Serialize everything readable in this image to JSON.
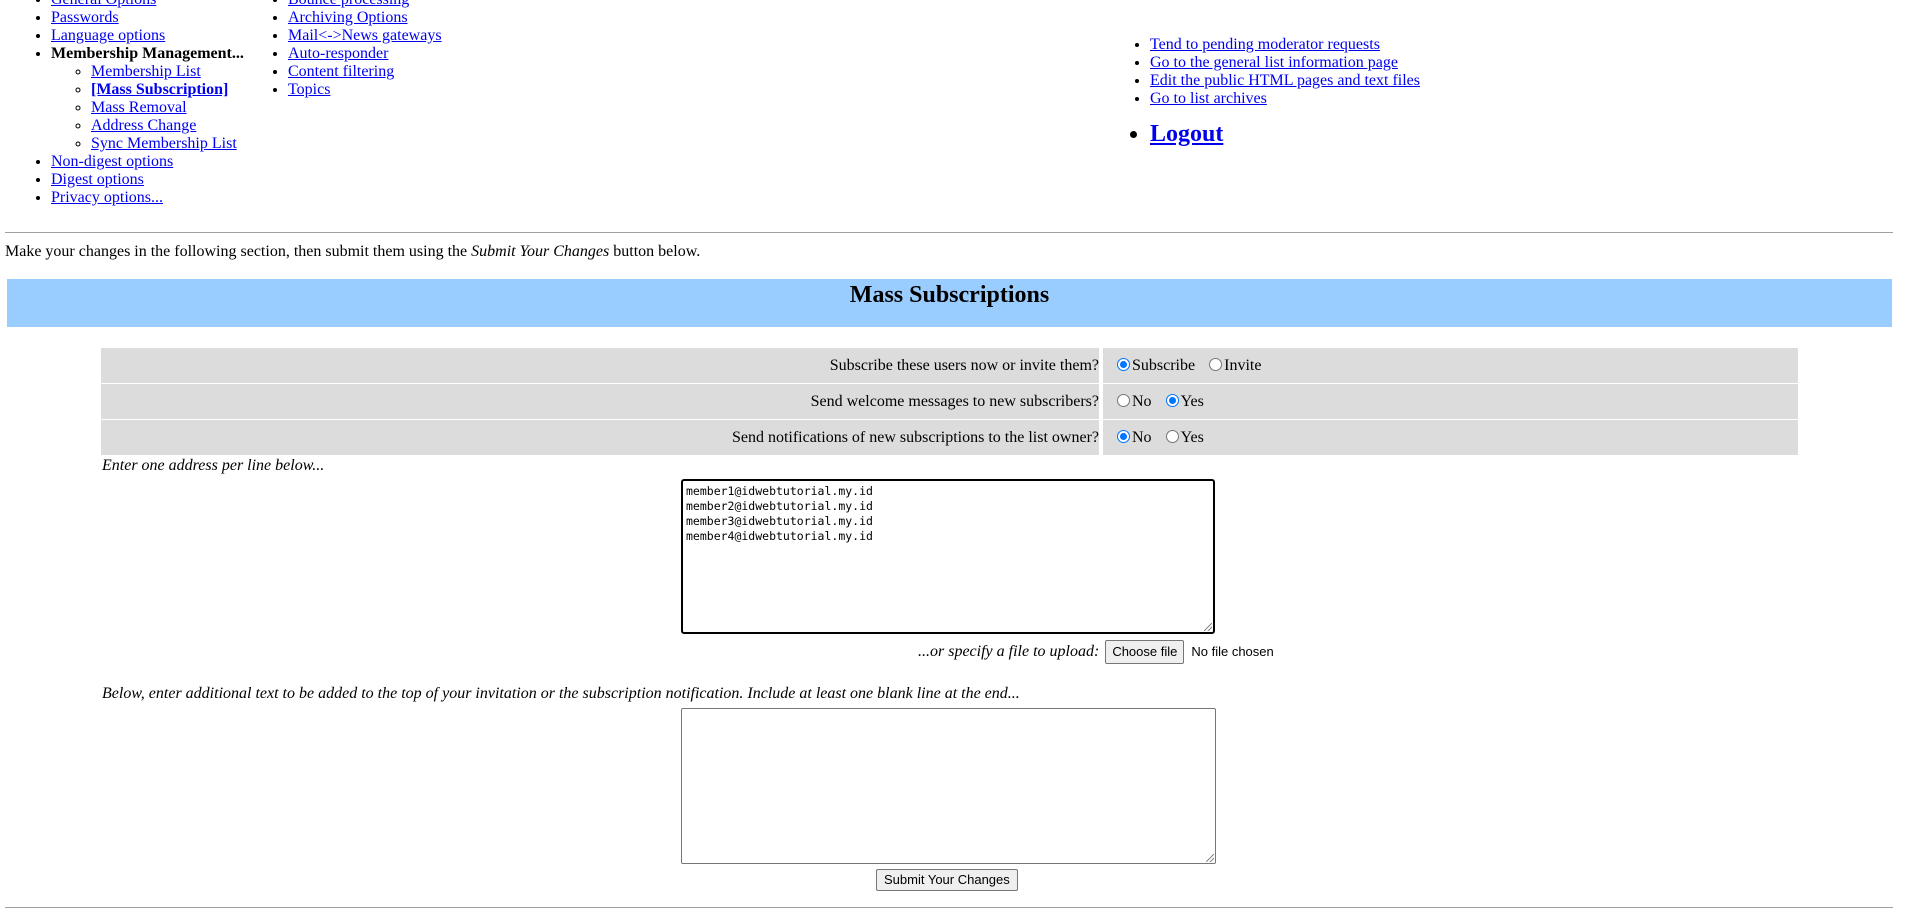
{
  "nav": {
    "col1": {
      "partial_top": "General Options",
      "items": [
        "Passwords",
        "Language options"
      ],
      "membership_heading": "Membership Management...",
      "membership_sub": [
        "Membership List",
        "[Mass Subscription]",
        "Mass Removal",
        "Address Change",
        "Sync Membership List"
      ],
      "after_items": [
        "Non-digest options",
        "Digest options",
        "Privacy options..."
      ]
    },
    "col2": {
      "partial_top": "Bounce processing",
      "items": [
        "Archiving Options",
        "Mail<->News gateways",
        "Auto-responder",
        "Content filtering",
        "Topics"
      ]
    },
    "col3": {
      "items": [
        "Tend to pending moderator requests",
        "Go to the general list information page",
        "Edit the public HTML pages and text files",
        "Go to list archives"
      ],
      "logout": "Logout"
    }
  },
  "intro": {
    "before": "Make your changes in the following section, then submit them using the ",
    "emphasis": "Submit Your Changes",
    "after": " button below."
  },
  "section_title": "Mass Subscriptions",
  "options": [
    {
      "question": "Subscribe these users now or invite them?",
      "choices": [
        "Subscribe",
        "Invite"
      ],
      "selected": "Subscribe"
    },
    {
      "question": "Send welcome messages to new subscribers?",
      "choices": [
        "No",
        "Yes"
      ],
      "selected": "Yes"
    },
    {
      "question": "Send notifications of new subscriptions to the list owner?",
      "choices": [
        "No",
        "Yes"
      ],
      "selected": "No"
    }
  ],
  "enter_hint": "Enter one address per line below...",
  "addresses": [
    "member1@idwebtutorial.my.id",
    "member2@idwebtutorial.my.id",
    "member3@idwebtutorial.my.id",
    "member4@idwebtutorial.my.id"
  ],
  "upload": {
    "label": "...or specify a file to upload:",
    "button": "Choose file",
    "status": "No file chosen"
  },
  "below_hint": "Below, enter additional text to be added to the top of your invitation or the subscription notification. Include at least one blank line at the end...",
  "extra_text": "",
  "submit_label": "Submit Your Changes",
  "colors": {
    "link": "#0000ee",
    "section_header_bg": "#99ccff",
    "row_bg": "#dcdcdc",
    "radio_on": "#0075ff"
  }
}
